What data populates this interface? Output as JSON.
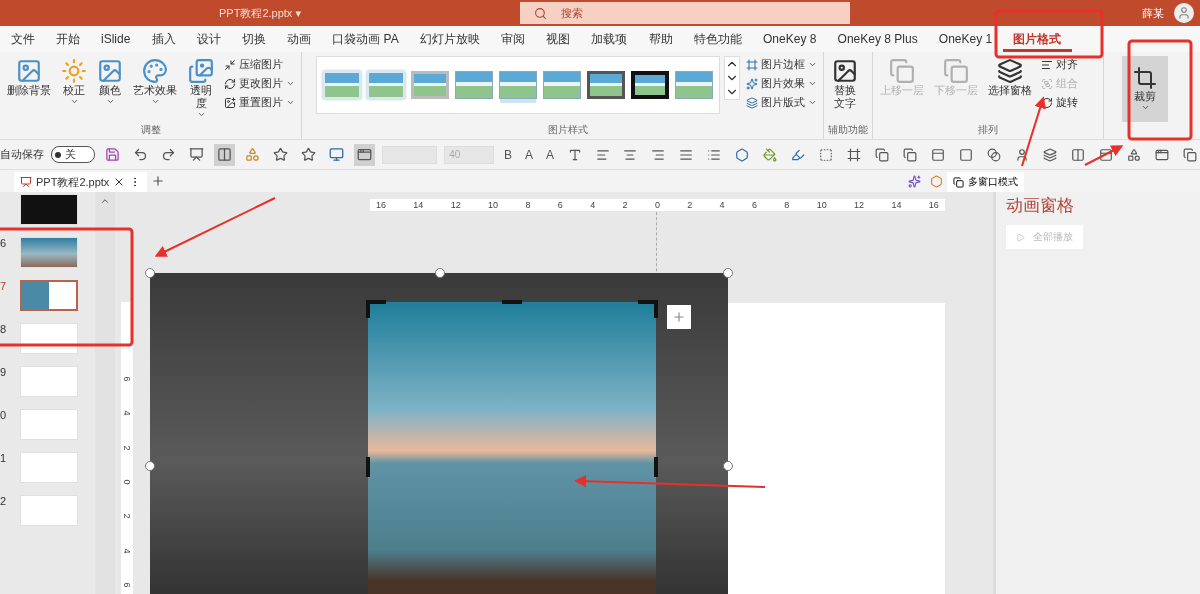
{
  "window": {
    "title": "PPT教程2.pptx",
    "title_caret": "▾",
    "search_placeholder": "搜索",
    "user": "薛某"
  },
  "menu_tabs": [
    {
      "label": "文件",
      "selected": false
    },
    {
      "label": "开始",
      "selected": false
    },
    {
      "label": "iSlide",
      "selected": false
    },
    {
      "label": "插入",
      "selected": false
    },
    {
      "label": "设计",
      "selected": false
    },
    {
      "label": "切换",
      "selected": false
    },
    {
      "label": "动画",
      "selected": false
    },
    {
      "label": "口袋动画 PA",
      "selected": false
    },
    {
      "label": "幻灯片放映",
      "selected": false
    },
    {
      "label": "审阅",
      "selected": false
    },
    {
      "label": "视图",
      "selected": false
    },
    {
      "label": "加载项",
      "selected": false
    },
    {
      "label": "帮助",
      "selected": false
    },
    {
      "label": "特色功能",
      "selected": false
    },
    {
      "label": "OneKey 8",
      "selected": false
    },
    {
      "label": "OneKey 8 Plus",
      "selected": false
    },
    {
      "label": "OneKey 1",
      "selected": false
    },
    {
      "label": "图片格式",
      "selected": true
    }
  ],
  "ribbon": {
    "adjust": {
      "label": "调整",
      "large": [
        {
          "label": "删除背景",
          "dropdown": false
        },
        {
          "label": "校正",
          "dropdown": true
        },
        {
          "label": "颜色",
          "dropdown": true
        },
        {
          "label": "艺术效果",
          "dropdown": true
        },
        {
          "label": "透明度",
          "dropdown": true
        }
      ],
      "small": [
        {
          "label": "压缩图片",
          "dropdown": false
        },
        {
          "label": "更改图片",
          "dropdown": true
        },
        {
          "label": "重置图片",
          "dropdown": true
        }
      ]
    },
    "styles": {
      "label": "图片样式",
      "gallery": [
        {
          "kind": "soft"
        },
        {
          "kind": "soft"
        },
        {
          "kind": "grey"
        },
        {
          "kind": "plain"
        },
        {
          "kind": "reflect"
        },
        {
          "kind": "plain"
        },
        {
          "kind": "dark"
        },
        {
          "kind": "black"
        },
        {
          "kind": "plain"
        }
      ],
      "small": [
        {
          "label": "图片边框",
          "dropdown": true
        },
        {
          "label": "图片效果",
          "dropdown": true
        },
        {
          "label": "图片版式",
          "dropdown": true
        }
      ]
    },
    "accessibility": {
      "label": "辅助功能",
      "large": [
        {
          "label": "替换文字",
          "dropdown": false
        }
      ]
    },
    "arrange": {
      "label": "排列",
      "large": [
        {
          "label": "上移一层",
          "disabled": true
        },
        {
          "label": "下移一层",
          "disabled": true
        },
        {
          "label": "选择窗格",
          "disabled": false
        }
      ],
      "small": [
        {
          "label": "对齐",
          "disabled": false
        },
        {
          "label": "组合",
          "disabled": true
        },
        {
          "label": "旋转",
          "disabled": false
        }
      ]
    },
    "crop": {
      "label": "裁剪",
      "active": true
    }
  },
  "quick_access": {
    "autosave_label": "自动保存",
    "autosave_on": false,
    "autosave_state": "关",
    "font_size": "40",
    "format_buttons": [
      "B",
      "A",
      "A"
    ]
  },
  "file_tabs": [
    {
      "label": "PPT教程2.pptx",
      "selected": true
    }
  ],
  "window_mode_button": "多窗口模式",
  "thumbnails": [
    {
      "kind": "dark",
      "selected": false
    },
    {
      "number": "6",
      "kind": "photo",
      "selected": false
    },
    {
      "number": "7",
      "kind": "photo-half",
      "selected": true
    },
    {
      "number": "8",
      "kind": "blank",
      "selected": false
    },
    {
      "number": "9",
      "kind": "blank",
      "selected": false
    },
    {
      "number": "0",
      "kind": "blank",
      "selected": false
    },
    {
      "number": "1",
      "kind": "blank",
      "selected": false
    },
    {
      "number": "2",
      "kind": "blank",
      "selected": false
    }
  ],
  "ruler": {
    "horizontal": [
      "16",
      "14",
      "12",
      "10",
      "8",
      "6",
      "4",
      "2",
      "0",
      "2",
      "4",
      "6",
      "8",
      "10",
      "12",
      "14",
      "16"
    ],
    "vertical": [
      "6",
      "4",
      "2",
      "0",
      "2",
      "4",
      "6"
    ]
  },
  "animation_pane": {
    "title": "动画窗格",
    "play_all": {
      "label": "全部播放",
      "disabled": true
    }
  }
}
